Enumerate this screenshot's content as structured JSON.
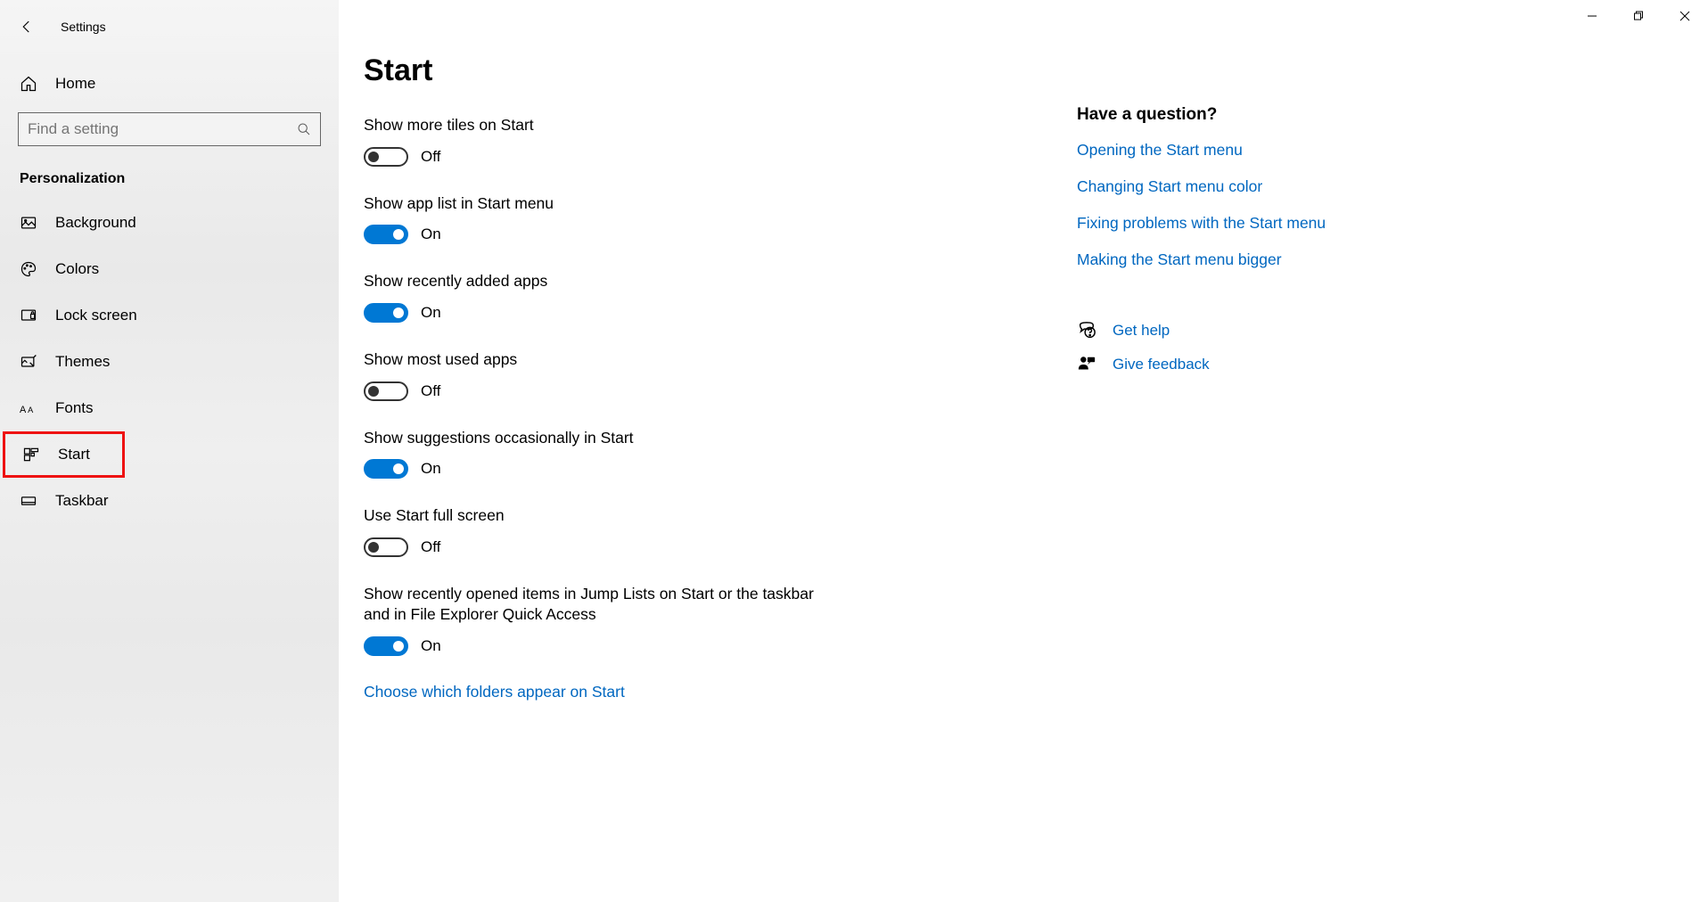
{
  "window_title": "Settings",
  "sidebar": {
    "home": "Home",
    "search_placeholder": "Find a setting",
    "section": "Personalization",
    "items": [
      {
        "label": "Background"
      },
      {
        "label": "Colors"
      },
      {
        "label": "Lock screen"
      },
      {
        "label": "Themes"
      },
      {
        "label": "Fonts"
      },
      {
        "label": "Start"
      },
      {
        "label": "Taskbar"
      }
    ]
  },
  "page": {
    "title": "Start",
    "settings": [
      {
        "label": "Show more tiles on Start",
        "state": "Off",
        "on": false
      },
      {
        "label": "Show app list in Start menu",
        "state": "On",
        "on": true
      },
      {
        "label": "Show recently added apps",
        "state": "On",
        "on": true
      },
      {
        "label": "Show most used apps",
        "state": "Off",
        "on": false
      },
      {
        "label": "Show suggestions occasionally in Start",
        "state": "On",
        "on": true
      },
      {
        "label": "Use Start full screen",
        "state": "Off",
        "on": false
      },
      {
        "label": "Show recently opened items in Jump Lists on Start or the taskbar and in File Explorer Quick Access",
        "state": "On",
        "on": true
      }
    ],
    "choose_folders": "Choose which folders appear on Start"
  },
  "help": {
    "title": "Have a question?",
    "links": [
      "Opening the Start menu",
      "Changing Start menu color",
      "Fixing problems with the Start menu",
      "Making the Start menu bigger"
    ],
    "get_help": "Get help",
    "give_feedback": "Give feedback"
  }
}
